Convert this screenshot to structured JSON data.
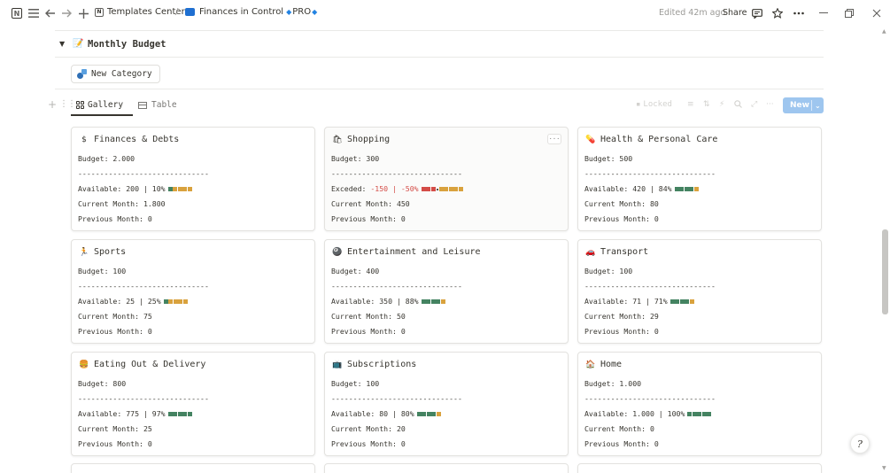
{
  "topbar": {
    "breadcrumb_1": "Templates Center",
    "breadcrumb_separator": "/",
    "breadcrumb_2": "Finances in Control",
    "breadcrumb_2_suffix": "PRO",
    "edited": "Edited 42m ago",
    "share": "Share"
  },
  "section": {
    "toggle_glyph": "▼",
    "icon": "📝",
    "title": "Monthly Budget",
    "new_category_label": "New Category"
  },
  "views": {
    "gallery_label": "Gallery",
    "table_label": "Table",
    "locked_label": "Locked",
    "new_label": "New"
  },
  "colors": {
    "green": "#448361",
    "orange": "#d9a23d",
    "red": "#d44c47",
    "new_button": "#9ec6ef"
  },
  "cards": [
    {
      "icon": "$",
      "title": "Finances & Debts",
      "budget": "Budget: 2.000",
      "divider": "------------------------------",
      "available_prefix": "Available: 200 | 10%",
      "bar": [
        "g",
        "o",
        "o",
        "o",
        "o"
      ],
      "current": "Current Month: 1.800",
      "previous": "Previous Month: 0"
    },
    {
      "icon": "🛍",
      "title": "Shopping",
      "budget": "Budget: 300",
      "divider": "------------------------------",
      "exceeded_label": "Exceded:",
      "exceeded_value": "-150 | -50%",
      "bar": [
        "r",
        "r",
        "r",
        "dot",
        "o",
        "o",
        "o",
        "o",
        "o"
      ],
      "current": "Current Month: 450",
      "previous": "Previous Month: 0",
      "more": "···"
    },
    {
      "icon": "💊",
      "title": "Health & Personal Care",
      "budget": "Budget: 500",
      "divider": "------------------------------",
      "available_prefix": "Available: 420 | 84%",
      "bar": [
        "g",
        "g",
        "g",
        "g",
        "o"
      ],
      "current": "Current Month: 80",
      "previous": "Previous Month: 0"
    },
    {
      "icon": "🏃",
      "title": "Sports",
      "budget": "Budget: 100",
      "divider": "------------------------------",
      "available_prefix": "Available: 25 | 25%",
      "bar": [
        "g",
        "o",
        "o",
        "o",
        "o"
      ],
      "current": "Current Month: 75",
      "previous": "Previous Month: 0"
    },
    {
      "icon": "🎱",
      "title": "Entertainment and Leisure",
      "budget": "Budget: 400",
      "divider": "------------------------------",
      "available_prefix": "Available: 350 | 88%",
      "bar": [
        "g",
        "g",
        "g",
        "g",
        "o"
      ],
      "current": "Current Month: 50",
      "previous": "Previous Month: 0"
    },
    {
      "icon": "🚗",
      "title": "Transport",
      "budget": "Budget: 100",
      "divider": "------------------------------",
      "available_prefix": "Available: 71 | 71%",
      "bar": [
        "g",
        "g",
        "g",
        "g",
        "o"
      ],
      "current": "Current Month: 29",
      "previous": "Previous Month: 0"
    },
    {
      "icon": "🍔",
      "title": "Eating Out & Delivery",
      "budget": "Budget: 800",
      "divider": "------------------------------",
      "available_prefix": "Available: 775 | 97%",
      "bar": [
        "g",
        "g",
        "g",
        "g",
        "g"
      ],
      "current": "Current Month: 25",
      "previous": "Previous Month: 0"
    },
    {
      "icon": "📺",
      "title": "Subscriptions",
      "budget": "Budget: 100",
      "divider": "------------------------------",
      "available_prefix": "Available: 80 | 80%",
      "bar": [
        "g",
        "g",
        "g",
        "g",
        "o"
      ],
      "current": "Current Month: 20",
      "previous": "Previous Month: 0"
    },
    {
      "icon": "🏠",
      "title": "Home",
      "budget": "Budget: 1.000",
      "divider": "------------------------------",
      "available_prefix": "Available: 1.000 | 100%",
      "bar": [
        "g",
        "g",
        "g",
        "g",
        "g"
      ],
      "current": "Current Month: 0",
      "previous": "Previous Month: 0"
    }
  ],
  "help": "?"
}
